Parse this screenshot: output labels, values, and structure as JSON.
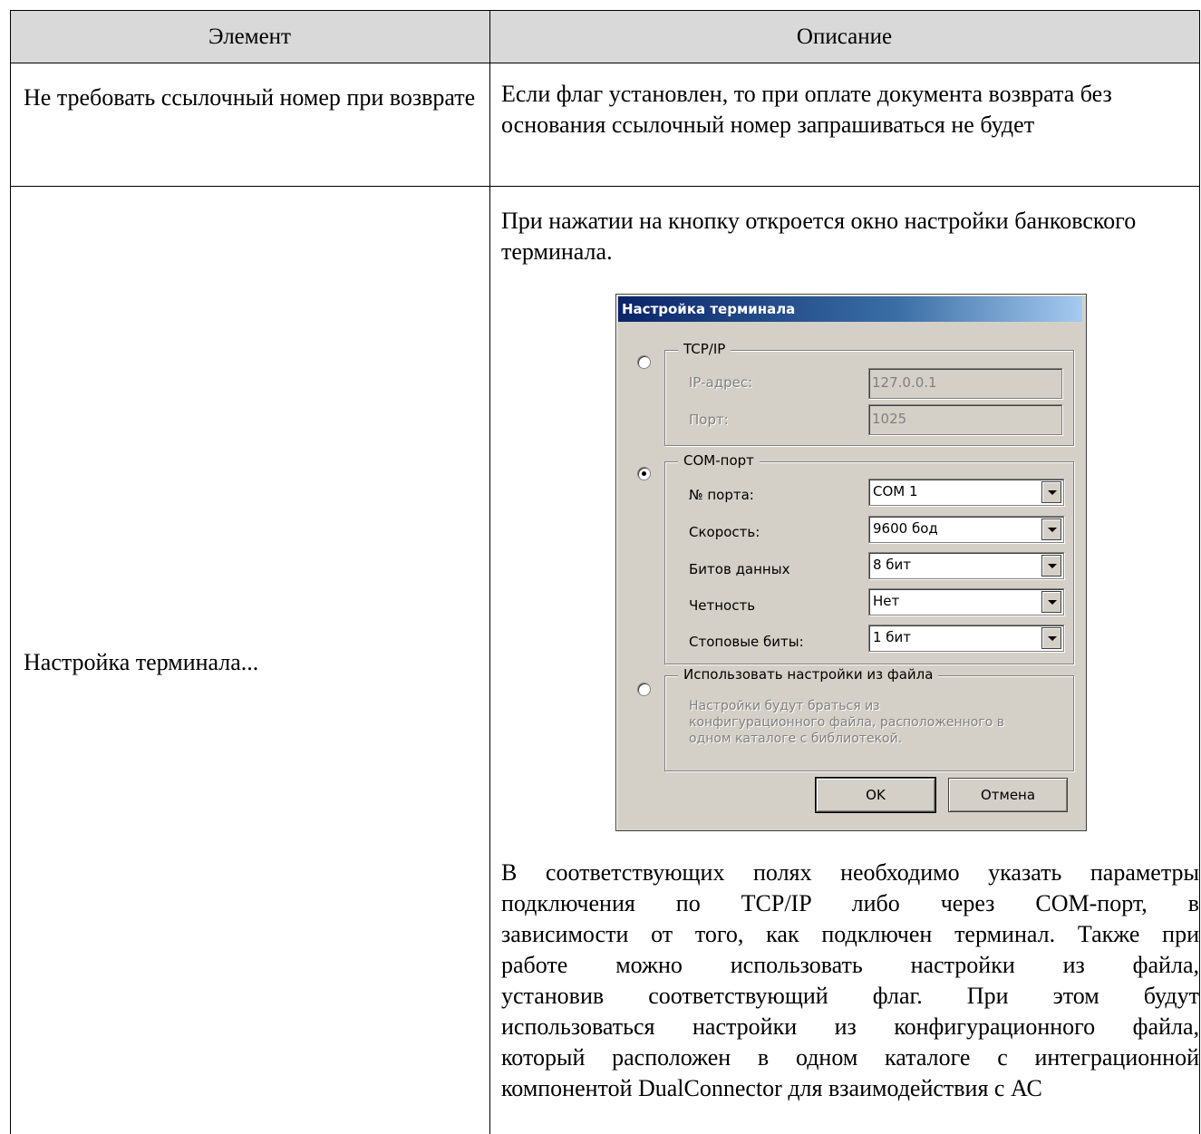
{
  "table": {
    "headers": [
      "Элемент",
      "Описание"
    ],
    "row1": {
      "element": "Не требовать ссылочный номер при возврате",
      "description": "Если флаг установлен, то при оплате документа возврата без основания ссылочный номер запрашиваться не будет"
    },
    "row2": {
      "element": "Настройка терминала...",
      "intro": "При нажатии на кнопку откроется окно настройки банковского терминала.",
      "paragraph_lines": [
        "В соответствующих полях необходимо указать параметры",
        "подключения по TCP/IP либо через COM-порт, в",
        "зависимости от того, как подключен терминал. Также при",
        "работе можно использовать настройки из файла,",
        "установив соответствующий флаг. При этом будут",
        "использоваться настройки из конфигурационного файла,",
        "который расположен в одном каталоге с интеграционной",
        "компонентой DualConnector для взаимодействия с АС"
      ]
    }
  },
  "dialog": {
    "title": "Настройка терминала",
    "tcp": {
      "legend": "TCP/IP",
      "ip_label": "IP-адрес:",
      "ip_value": "127.0.0.1",
      "port_label": "Порт:",
      "port_value": "1025",
      "selected": false
    },
    "com": {
      "legend": "COM-порт",
      "selected": true,
      "fields": [
        {
          "label": "№ порта:",
          "value": "COM 1"
        },
        {
          "label": "Скорость:",
          "value": "9600 бод"
        },
        {
          "label": "Битов данных",
          "value": "8 бит"
        },
        {
          "label": "Четность",
          "value": "Нет"
        },
        {
          "label": "Стоповые биты:",
          "value": "1 бит"
        }
      ]
    },
    "file": {
      "legend": "Использовать настройки из файла",
      "selected": false,
      "note": "Настройки будут браться из конфигурационного файла, расположенного в одном каталоге с библиотекой."
    },
    "ok_label": "OK",
    "cancel_label": "Отмена"
  }
}
